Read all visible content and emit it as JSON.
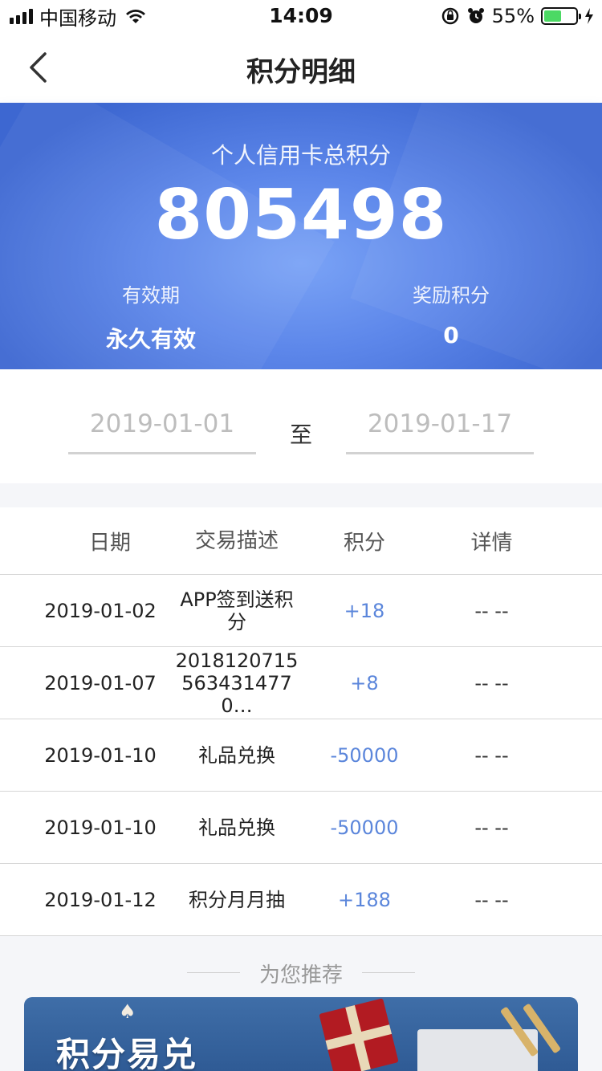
{
  "status_bar": {
    "carrier": "中国移动",
    "time": "14:09",
    "battery_percent": "55%",
    "battery_level": 0.55
  },
  "nav": {
    "title": "积分明细"
  },
  "summary": {
    "label": "个人信用卡总积分",
    "total": "805498",
    "validity_label": "有效期",
    "validity_value": "永久有效",
    "bonus_label": "奖励积分",
    "bonus_value": "0"
  },
  "date_range": {
    "start": "2019-01-01",
    "separator": "至",
    "end": "2019-01-17"
  },
  "table": {
    "headers": [
      "日期",
      "交易描述",
      "积分",
      "详情"
    ],
    "rows": [
      {
        "date": "2019-01-02",
        "desc": "APP签到送积分",
        "points": "+18",
        "detail": "-- --"
      },
      {
        "date": "2019-01-07",
        "desc": "20181207155634314770…",
        "points": "+8",
        "detail": "-- --"
      },
      {
        "date": "2019-01-10",
        "desc": "礼品兑换",
        "points": "-50000",
        "detail": "-- --"
      },
      {
        "date": "2019-01-10",
        "desc": "礼品兑换",
        "points": "-50000",
        "detail": "-- --"
      },
      {
        "date": "2019-01-12",
        "desc": "积分月月抽",
        "points": "+188",
        "detail": "-- --"
      }
    ]
  },
  "recommend": {
    "title": "为您推荐",
    "card_title": "积分易兑"
  },
  "colors": {
    "banner": "#5d87ea",
    "points_text": "#5b86db",
    "battery_fill": "#4cd964"
  }
}
